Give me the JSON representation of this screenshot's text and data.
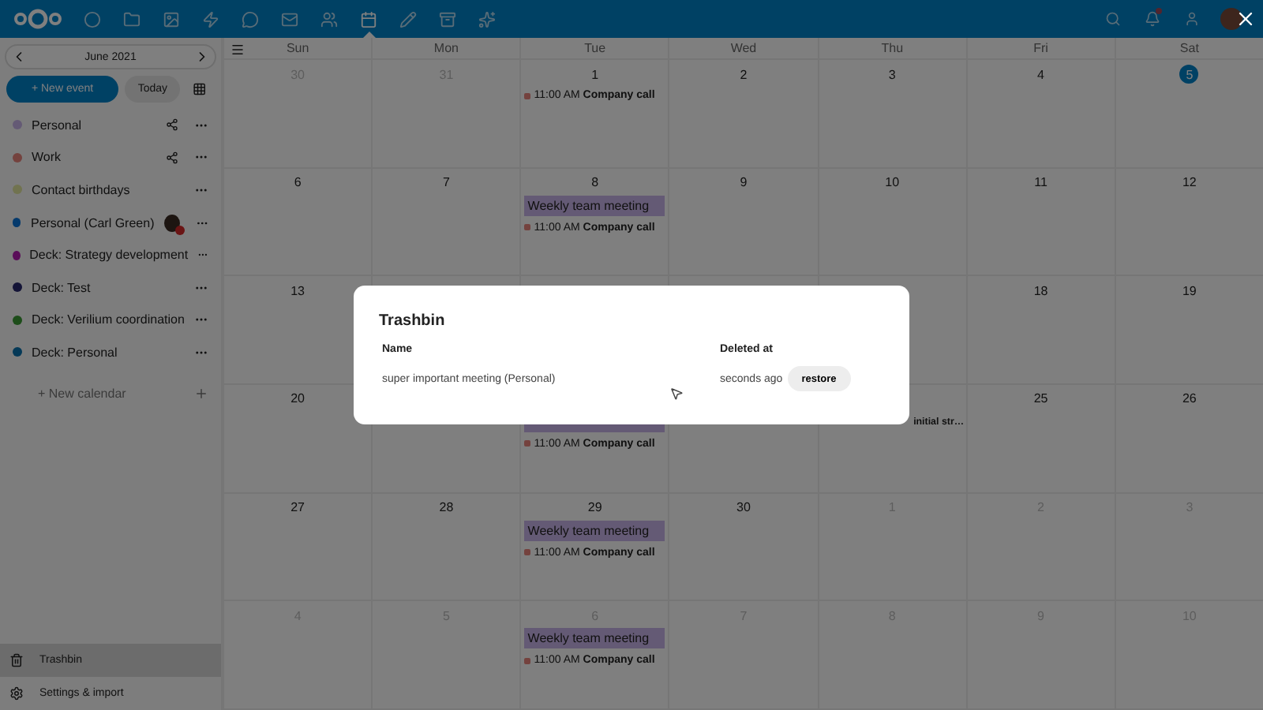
{
  "top_bar": {
    "apps": [
      {
        "kind": "circle",
        "selected": false
      },
      {
        "kind": "folder",
        "selected": false
      },
      {
        "kind": "image",
        "selected": false
      },
      {
        "kind": "zap",
        "selected": false
      },
      {
        "kind": "chat",
        "selected": false
      },
      {
        "kind": "mail",
        "selected": false
      },
      {
        "kind": "contacts",
        "selected": false
      },
      {
        "kind": "calendar",
        "selected": true
      },
      {
        "kind": "pencil",
        "selected": false
      },
      {
        "kind": "deck",
        "selected": false
      },
      {
        "kind": "star",
        "selected": false
      }
    ],
    "right": [
      {
        "kind": "search"
      },
      {
        "kind": "bell",
        "unread": true
      },
      {
        "kind": "user"
      },
      {
        "kind": "avatar"
      }
    ]
  },
  "sidebar": {
    "month": "June 2021",
    "new_event": "+ New event",
    "today": "Today",
    "calendars": [
      {
        "name": "Personal",
        "color": "#645a75",
        "shared": true,
        "owner_avatar": false
      },
      {
        "name": "Work",
        "color": "#74423e",
        "shared": true,
        "owner_avatar": false
      },
      {
        "name": "Contact birthdays",
        "color": "#717350",
        "shared": false,
        "owner_avatar": false
      },
      {
        "name": "Personal (Carl Green)",
        "color": "#053a6c",
        "shared": false,
        "owner_avatar": true
      },
      {
        "name": "Deck: Strategy development",
        "color": "#5a0d59",
        "shared": false,
        "owner_avatar": false
      },
      {
        "name": "Deck: Test",
        "color": "#141437",
        "shared": false,
        "owner_avatar": false
      },
      {
        "name": "Deck: Verilium coordination",
        "color": "#1d4d1a",
        "shared": false,
        "owner_avatar": false
      },
      {
        "name": "Deck: Personal",
        "color": "#053957",
        "shared": false,
        "owner_avatar": false
      }
    ],
    "new_calendar": "+ New calendar",
    "footer": [
      {
        "kind": "trash",
        "label": "Trashbin",
        "selected": true
      },
      {
        "kind": "settings",
        "label": "Settings & import",
        "selected": false
      }
    ]
  },
  "calendar": {
    "weekdays": [
      "Sun",
      "Mon",
      "Tue",
      "Wed",
      "Thu",
      "Fri",
      "Sat"
    ],
    "weeks": [
      [
        {
          "kind": "day",
          "number": "30",
          "muted": true
        },
        {
          "kind": "day",
          "number": "31",
          "muted": true
        },
        {
          "kind": "day",
          "number": "1",
          "events": [
            {
              "kind": "timed",
              "time": "11:00 AM",
              "title": "Company call"
            }
          ]
        },
        {
          "kind": "day",
          "number": "2"
        },
        {
          "kind": "day",
          "number": "3"
        },
        {
          "kind": "day",
          "number": "4"
        },
        {
          "kind": "day",
          "number": "5",
          "today": true
        }
      ],
      [
        {
          "kind": "day",
          "number": "6"
        },
        {
          "kind": "day",
          "number": "7"
        },
        {
          "kind": "day",
          "number": "8",
          "events": [
            {
              "kind": "allday",
              "title": "Weekly team meeting"
            },
            {
              "kind": "timed",
              "time": "11:00 AM",
              "title": "Company call"
            }
          ]
        },
        {
          "kind": "day",
          "number": "9"
        },
        {
          "kind": "day",
          "number": "10"
        },
        {
          "kind": "day",
          "number": "11"
        },
        {
          "kind": "day",
          "number": "12"
        }
      ],
      [
        {
          "kind": "day",
          "number": "13"
        },
        {
          "kind": "covered"
        },
        {
          "kind": "covered"
        },
        {
          "kind": "covered"
        },
        {
          "kind": "covered"
        },
        {
          "kind": "day",
          "number": "18"
        },
        {
          "kind": "day",
          "number": "19"
        }
      ],
      [
        {
          "kind": "day",
          "number": "20"
        },
        {
          "kind": "covered"
        },
        {
          "kind": "covered",
          "events": [
            {
              "kind": "bar"
            },
            {
              "kind": "timed",
              "time": "11:00 AM",
              "title": "Company call"
            }
          ]
        },
        {
          "kind": "covered"
        },
        {
          "kind": "covered",
          "events": [
            {
              "kind": "partial",
              "title": "initial str…"
            }
          ]
        },
        {
          "kind": "day",
          "number": "25"
        },
        {
          "kind": "day",
          "number": "26"
        }
      ],
      [
        {
          "kind": "day",
          "number": "27"
        },
        {
          "kind": "day",
          "number": "28"
        },
        {
          "kind": "day",
          "number": "29",
          "events": [
            {
              "kind": "allday",
              "title": "Weekly team meeting"
            },
            {
              "kind": "timed",
              "time": "11:00 AM",
              "title": "Company call"
            }
          ]
        },
        {
          "kind": "day",
          "number": "30"
        },
        {
          "kind": "day",
          "number": "1",
          "muted": true
        },
        {
          "kind": "day",
          "number": "2",
          "muted": true
        },
        {
          "kind": "day",
          "number": "3",
          "muted": true
        }
      ],
      [
        {
          "kind": "day",
          "number": "4",
          "muted": true
        },
        {
          "kind": "day",
          "number": "5",
          "muted": true
        },
        {
          "kind": "day",
          "number": "6",
          "muted": true,
          "events": [
            {
              "kind": "allday",
              "title": "Weekly team meeting"
            },
            {
              "kind": "timed",
              "time": "11:00 AM",
              "title": "Company call"
            }
          ]
        },
        {
          "kind": "day",
          "number": "7",
          "muted": true
        },
        {
          "kind": "day",
          "number": "8",
          "muted": true
        },
        {
          "kind": "day",
          "number": "9",
          "muted": true
        },
        {
          "kind": "day",
          "number": "10",
          "muted": true
        }
      ]
    ]
  },
  "modal": {
    "title": "Trashbin",
    "columns": [
      "Name",
      "Deleted at"
    ],
    "rows": [
      {
        "name": "super important meeting (Personal)",
        "deleted": "seconds ago",
        "action": "restore"
      }
    ]
  }
}
